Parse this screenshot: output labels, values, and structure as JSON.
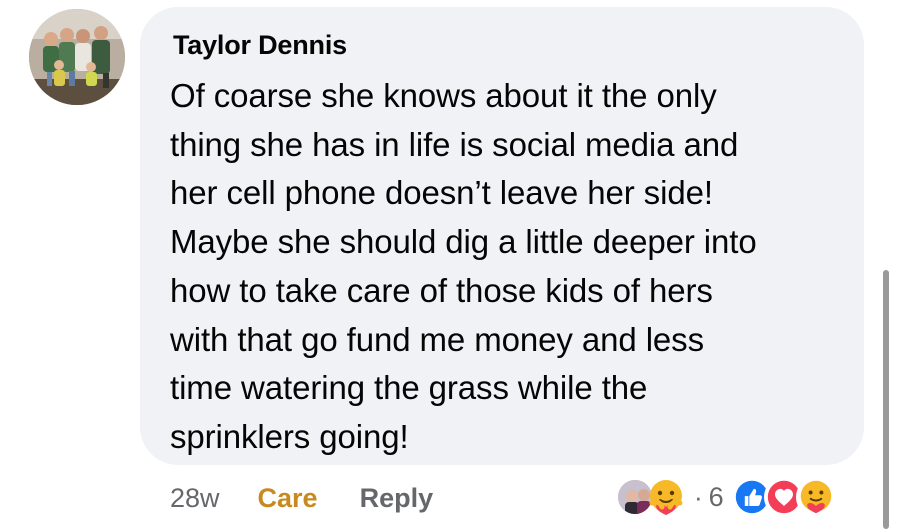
{
  "comment": {
    "author": "Taylor Dennis",
    "text_lines": [
      "Of coarse she knows about it the only",
      "thing she has in life is social media and",
      "her cell phone doesn’t leave her side!",
      "Maybe she should dig a little deeper into",
      "how to take care of those kids of hers",
      "with that go fund me money and less",
      "time watering the grass while the",
      "sprinklers going!"
    ]
  },
  "actions": {
    "timestamp": "28w",
    "care_label": "Care",
    "reply_label": "Reply"
  },
  "reactions": {
    "separator": "·",
    "count": "6",
    "types": [
      "like-icon",
      "love-icon",
      "care-icon"
    ]
  },
  "colors": {
    "bubble": "#f0f2f5",
    "care": "#c88a1e",
    "like": "#1877f2",
    "love": "#f33e58",
    "muted": "#65676b"
  }
}
